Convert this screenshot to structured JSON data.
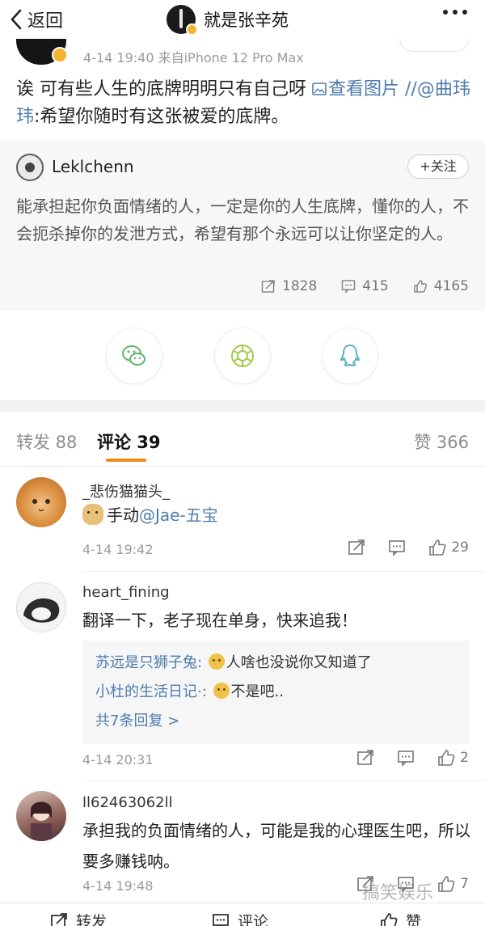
{
  "nav": {
    "back_label": "返回",
    "title": "就是张辛苑"
  },
  "post": {
    "time_source": "4-14 19:40  来自iPhone 12 Pro Max",
    "text_main": "诶 可有些人生的底牌明明只有自己呀 ",
    "view_image": "查看图片",
    "repost_prefix": " //@",
    "repost_user": "曲玮玮",
    "repost_text": ":希望你随时有这张被爱的底牌。"
  },
  "repost": {
    "author": "Leklchenn",
    "follow_label": "+关注",
    "text": "能承担起你负面情绪的人，一定是你的人生底牌，懂你的人，不会扼杀掉你的发泄方式，希望有那个永远可以让你坚定的人。",
    "reposts": "1828",
    "comments": "415",
    "likes": "4165"
  },
  "share": {
    "items": [
      {
        "icon": "wechat-icon"
      },
      {
        "icon": "moments-icon"
      },
      {
        "icon": "qq-icon"
      }
    ]
  },
  "tabs": {
    "repost": "转发 88",
    "comments": "评论 39",
    "likes": "赞 366"
  },
  "comments": [
    {
      "user": "_悲伤猫猫头_",
      "text_pre": "手动",
      "mention": "@Jae-五宝",
      "time": "4-14 19:42",
      "likes": "29"
    },
    {
      "user": "heart_fining",
      "text": "翻译一下，老子现在单身，快来追我！",
      "replies": [
        {
          "user": "苏远是只狮子兔:",
          "text": "人啥也没说你又知道了"
        },
        {
          "user": "小杜的生活日记·:",
          "text": "不是吧.."
        }
      ],
      "more_replies": "共7条回复 >",
      "time": "4-14 20:31",
      "likes": "2"
    },
    {
      "user": "ll62463062ll",
      "text": "承担我的负面情绪的人，可能是我的心理医生吧，所以要多赚钱呐。",
      "time": "4-14 19:48",
      "likes": "7"
    }
  ],
  "bottom_bar": {
    "repost": "转发",
    "comment": "评论",
    "like": "赞"
  },
  "watermark": "搞笑娱乐"
}
